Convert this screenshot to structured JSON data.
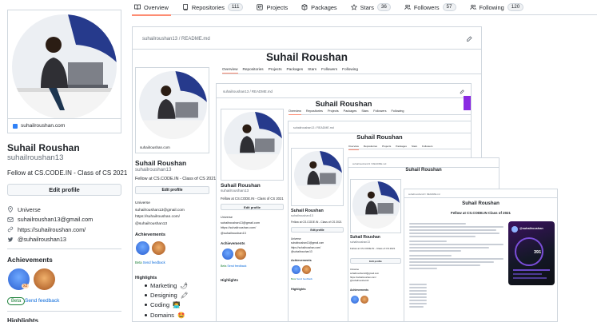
{
  "tabs": [
    {
      "label": "Overview",
      "icon": "book-icon",
      "active": true
    },
    {
      "label": "Repositories",
      "count": "111",
      "icon": "repo-icon"
    },
    {
      "label": "Projects",
      "icon": "project-icon"
    },
    {
      "label": "Packages",
      "icon": "package-icon"
    },
    {
      "label": "Stars",
      "count": "36",
      "icon": "star-icon"
    },
    {
      "label": "Followers",
      "count": "57",
      "icon": "people-icon"
    },
    {
      "label": "Following",
      "count": "120",
      "icon": "people-icon"
    }
  ],
  "profile": {
    "website_card": "suhailroushan.com",
    "name": "Suhail Roushan",
    "login": "suhailroushan13",
    "bio": "Fellow at CS.CODE.IN - Class of CS 2021",
    "edit_button": "Edit profile",
    "details": [
      {
        "icon": "location-icon",
        "text": "Universe"
      },
      {
        "icon": "mail-icon",
        "text": "suhailroushan13@gmail.com"
      },
      {
        "icon": "link-icon",
        "text": "https://suhailroushan.com/"
      },
      {
        "icon": "twitter-icon",
        "text": "@suhailroushan13"
      }
    ],
    "achievements_title": "Achievements",
    "achievement_multiplier": "x2",
    "beta": "Beta",
    "send_feedback": "Send feedback",
    "highlights_title": "Highlights"
  },
  "readme": {
    "path": "suhailroushan13 / README.md",
    "title": "Suhail Roushan",
    "tagline": "Fellow at CS.CODE.IN Class of 2021",
    "highlights": [
      {
        "label": "Marketing",
        "emoji": "🌶"
      },
      {
        "label": "Designing",
        "emoji": "🖍"
      },
      {
        "label": "Coding",
        "emoji": "👨‍💻"
      },
      {
        "label": "Domains",
        "emoji": "🤩"
      }
    ],
    "card_handle": "@suhailroushan",
    "card_number": "391"
  },
  "colors": {
    "accent_underline": "#fd8c73",
    "link": "#0969da",
    "beta_green": "#1a7f37",
    "border": "#d0d7de"
  }
}
